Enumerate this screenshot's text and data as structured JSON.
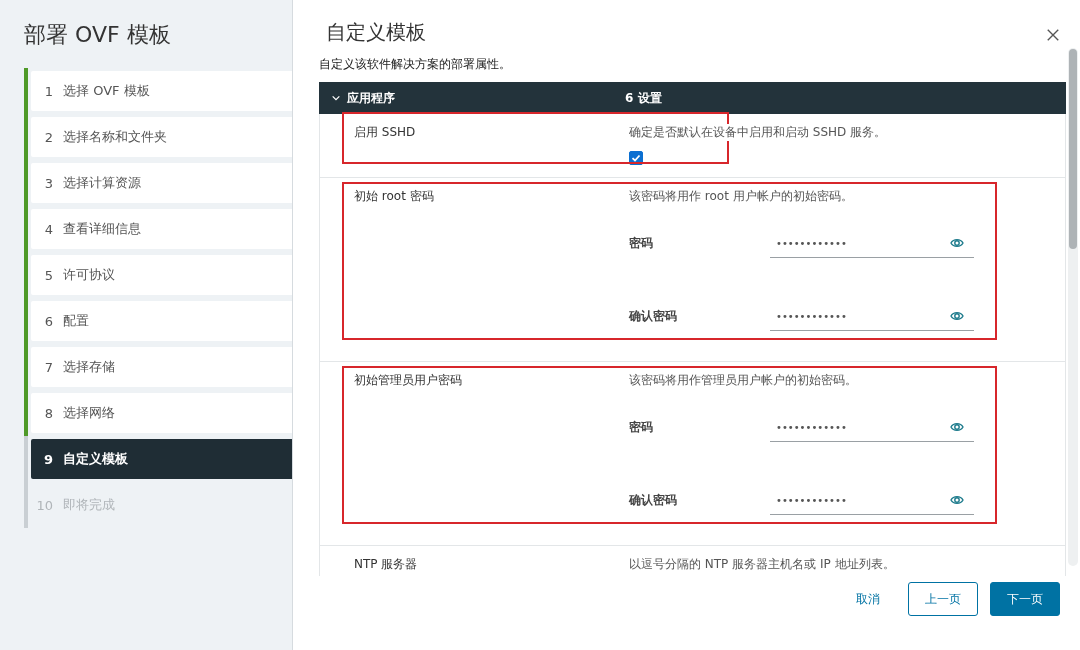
{
  "sidebar": {
    "title": "部署 OVF 模板",
    "steps": [
      {
        "number": "1",
        "label": "选择 OVF 模板",
        "selected": false,
        "completed": true,
        "disabled": false
      },
      {
        "number": "2",
        "label": "选择名称和文件夹",
        "selected": false,
        "completed": true,
        "disabled": false
      },
      {
        "number": "3",
        "label": "选择计算资源",
        "selected": false,
        "completed": true,
        "disabled": false
      },
      {
        "number": "4",
        "label": "查看详细信息",
        "selected": false,
        "completed": true,
        "disabled": false
      },
      {
        "number": "5",
        "label": "许可协议",
        "selected": false,
        "completed": true,
        "disabled": false
      },
      {
        "number": "6",
        "label": "配置",
        "selected": false,
        "completed": true,
        "disabled": false
      },
      {
        "number": "7",
        "label": "选择存储",
        "selected": false,
        "completed": true,
        "disabled": false
      },
      {
        "number": "8",
        "label": "选择网络",
        "selected": false,
        "completed": true,
        "disabled": false
      },
      {
        "number": "9",
        "label": "自定义模板",
        "selected": true,
        "completed": false,
        "disabled": false
      },
      {
        "number": "10",
        "label": "即将完成",
        "selected": false,
        "completed": false,
        "disabled": true
      }
    ]
  },
  "main": {
    "title": "自定义模板",
    "subtitle": "自定义该软件解决方案的部署属性。",
    "group": {
      "label": "应用程序",
      "count": "6 设置",
      "expanded": true
    },
    "settings": [
      {
        "kind": "checkbox",
        "label": "启用 SSHD",
        "description": "确定是否默认在设备中启用和启动 SSHD 服务。",
        "checked": true,
        "highlighted": true
      },
      {
        "kind": "passwords",
        "label": "初始 root 密码",
        "description": "该密码将用作 root 用户帐户的初始密码。",
        "highlighted": true,
        "fields": [
          {
            "label": "密码",
            "value": "••••••••••••"
          },
          {
            "label": "确认密码",
            "value": "••••••••••••"
          }
        ]
      },
      {
        "kind": "passwords",
        "label": "初始管理员用户密码",
        "description": "该密码将用作管理员用户帐户的初始密码。",
        "highlighted": true,
        "fields": [
          {
            "label": "密码",
            "value": "••••••••••••"
          },
          {
            "label": "确认密码",
            "value": "••••••••••••"
          }
        ]
      },
      {
        "kind": "text",
        "label": "NTP 服务器",
        "description": "以逗号分隔的 NTP 服务器主机名或 IP 地址列表。",
        "highlighted": false
      }
    ]
  },
  "footer": {
    "buttons": [
      {
        "kind": "link",
        "label": "取消"
      },
      {
        "kind": "outline",
        "label": "上一页"
      },
      {
        "kind": "primary",
        "label": "下一页"
      }
    ]
  }
}
